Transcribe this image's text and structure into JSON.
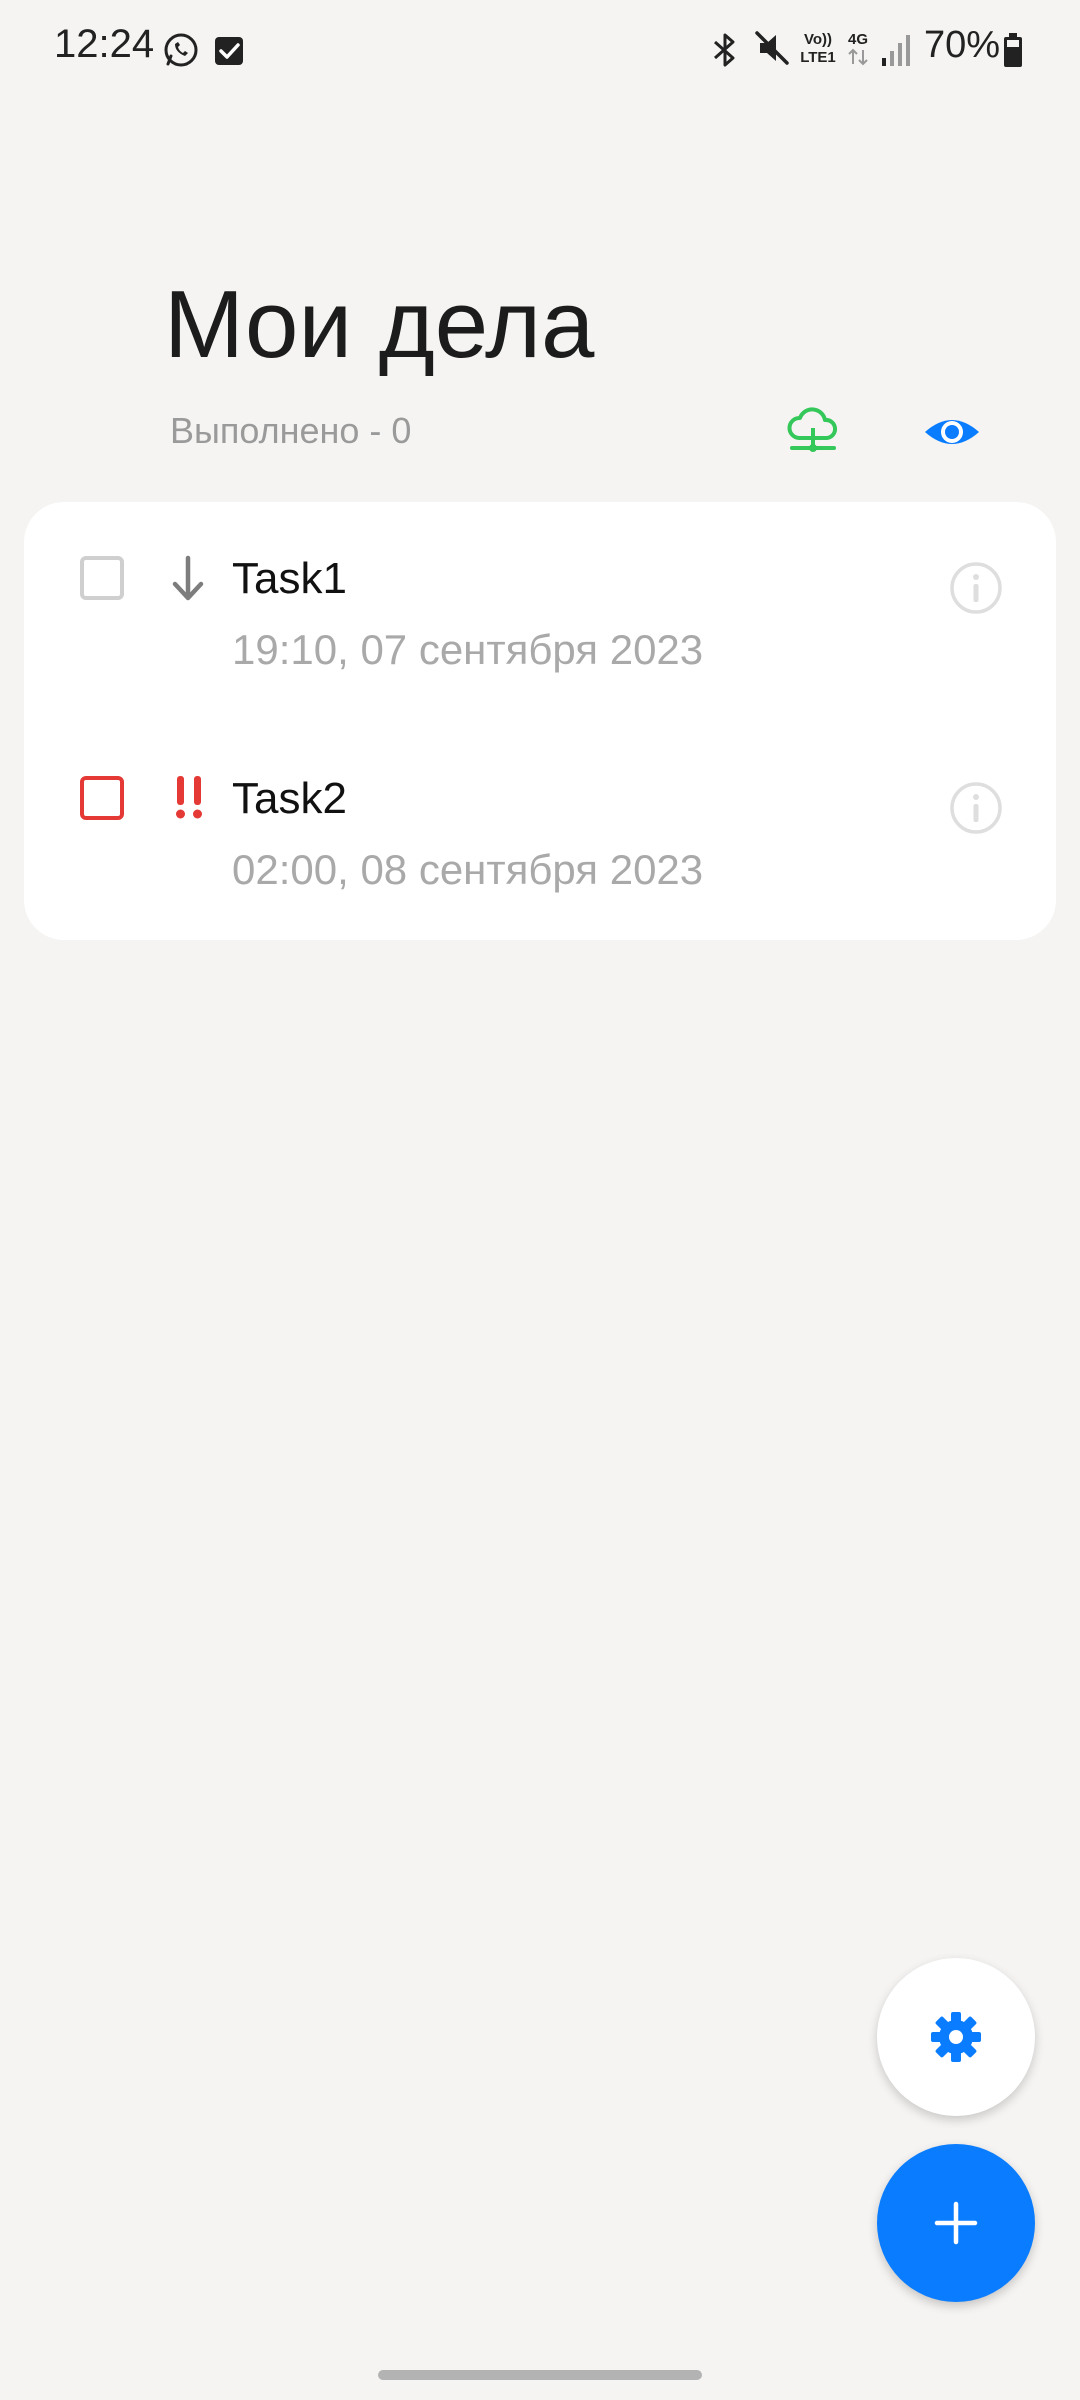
{
  "status_bar": {
    "time": "12:24",
    "battery": "70%",
    "icons": [
      "whatsapp-icon",
      "task-check-icon",
      "bluetooth-icon",
      "mute-icon",
      "volte-icon",
      "4g-icon",
      "signal-icon",
      "battery-icon"
    ]
  },
  "header": {
    "title": "Мои дела",
    "done_label": "Выполнено - 0",
    "icons": [
      "cloud-sync-icon",
      "eye-icon"
    ]
  },
  "tasks": [
    {
      "title": "Task1",
      "date": "19:10, 07 сентября 2023",
      "priority_icon": "arrow-down-icon",
      "checked": false
    },
    {
      "title": "Task2",
      "date": "02:00, 08 сентября 2023",
      "priority_icon": "double-exclamation-icon",
      "checked": false
    }
  ],
  "fabs": {
    "settings_icon": "gear-icon",
    "add_icon": "plus-icon"
  },
  "colors": {
    "background": "#F5F4F2",
    "accent": "#0A7CFF",
    "sync_green": "#34C759",
    "high_priority": "#E53935",
    "muted_text": "#A9A9A9"
  }
}
